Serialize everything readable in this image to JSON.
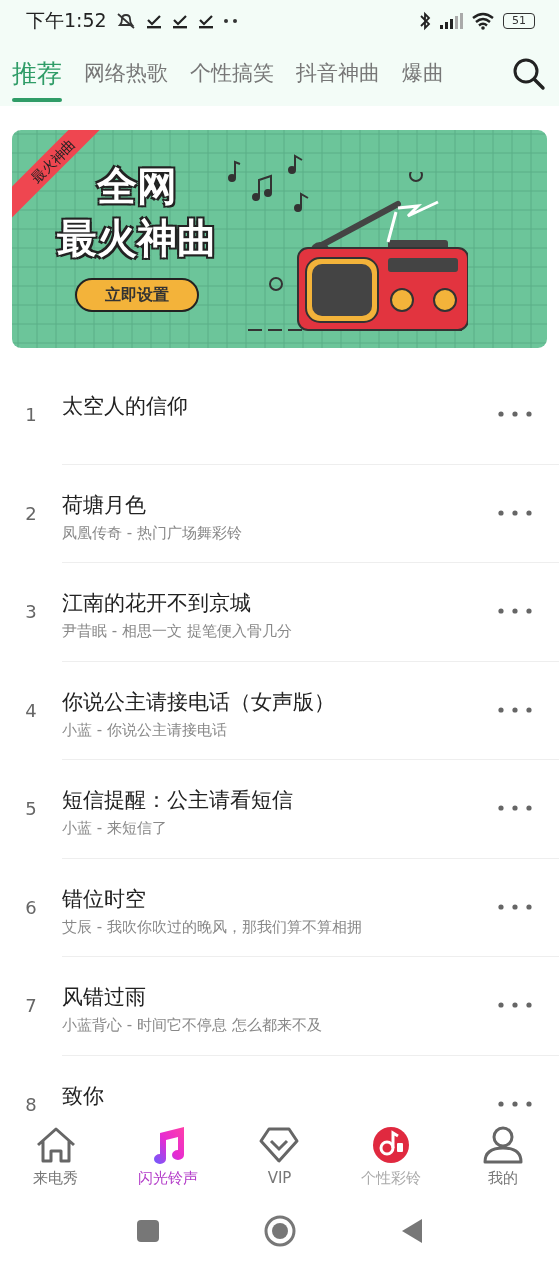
{
  "status_bar": {
    "time": "下午1:52",
    "battery": "51"
  },
  "tabs": [
    {
      "label": "推荐",
      "selected": true
    },
    {
      "label": "网络热歌",
      "selected": false
    },
    {
      "label": "个性搞笑",
      "selected": false
    },
    {
      "label": "抖音神曲",
      "selected": false
    },
    {
      "label": "爆曲",
      "selected": false
    }
  ],
  "banner": {
    "ribbon": "最火神曲",
    "title_lines": [
      "全网",
      "最火神曲"
    ],
    "button": "立即设置"
  },
  "songs": [
    {
      "rank": "1",
      "title": "太空人的信仰"
    },
    {
      "rank": "2",
      "title": "荷塘月色",
      "subtitle": "凤凰传奇 - 热门广场舞彩铃"
    },
    {
      "rank": "3",
      "title": "江南的花开不到京城",
      "subtitle": "尹昔眠 - 相思一文 提笔便入骨几分"
    },
    {
      "rank": "4",
      "title": "你说公主请接电话（女声版）",
      "subtitle": "小蓝 - 你说公主请接电话"
    },
    {
      "rank": "5",
      "title": "短信提醒：公主请看短信",
      "subtitle": "小蓝 - 来短信了"
    },
    {
      "rank": "6",
      "title": "错位时空",
      "subtitle": "艾辰 - 我吹你吹过的晚风，那我们算不算相拥"
    },
    {
      "rank": "7",
      "title": "风错过雨",
      "subtitle": "小蓝背心 - 时间它不停息 怎么都来不及"
    },
    {
      "rank": "8",
      "title": "致你"
    }
  ],
  "bottom_nav": [
    {
      "kind": "home",
      "label": "来电秀",
      "selected": false,
      "dimmed": false
    },
    {
      "kind": "note",
      "label": "闪光铃声",
      "selected": true,
      "dimmed": false
    },
    {
      "kind": "vip",
      "label": "VIP",
      "selected": false,
      "dimmed": false
    },
    {
      "kind": "disc",
      "label": "个性彩铃",
      "selected": false,
      "dimmed": true
    },
    {
      "kind": "user",
      "label": "我的",
      "selected": false,
      "dimmed": false
    }
  ]
}
